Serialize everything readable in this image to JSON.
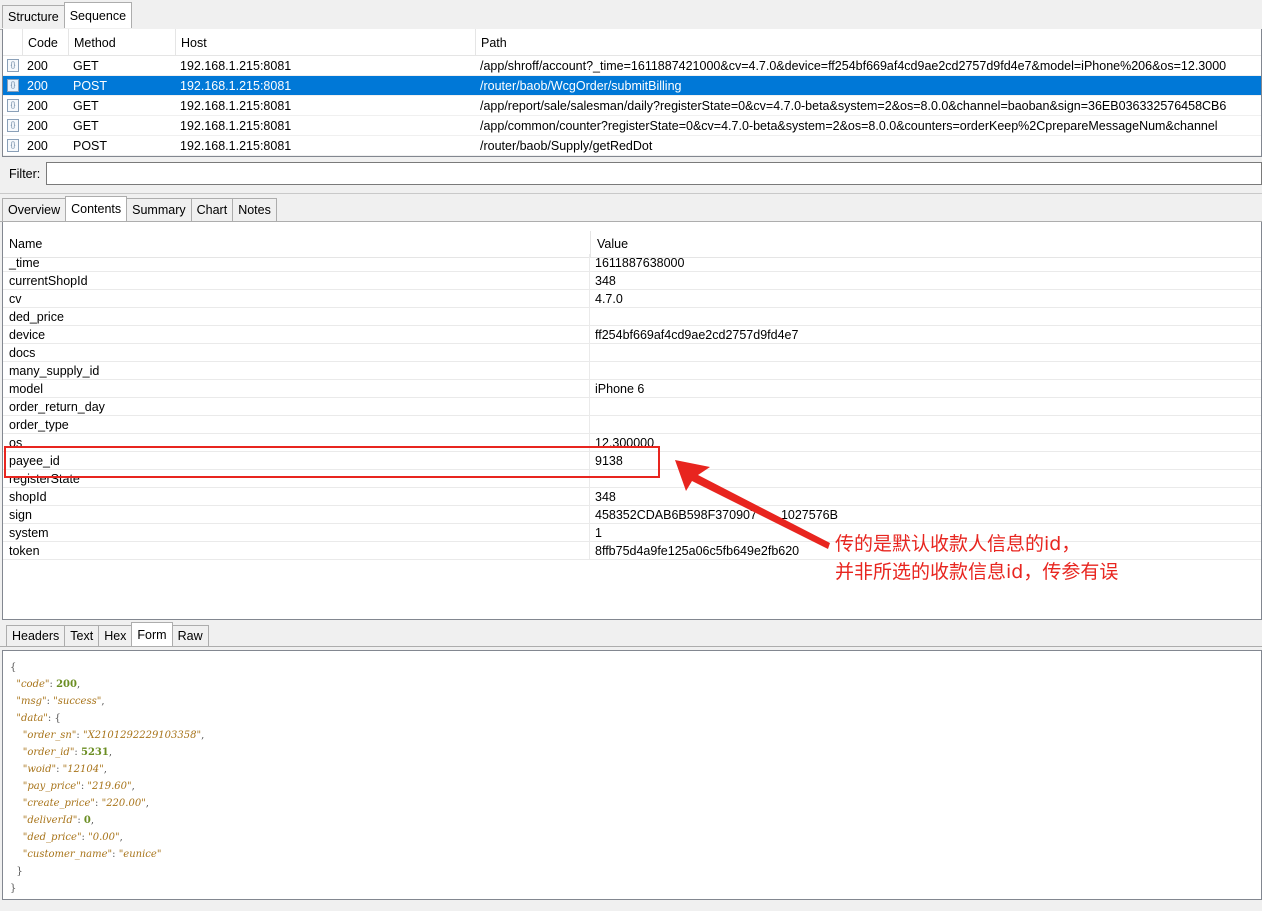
{
  "top_tabs": [
    {
      "label": "Structure",
      "active": false
    },
    {
      "label": "Sequence",
      "active": true
    }
  ],
  "sequence": {
    "columns": [
      "Code",
      "Method",
      "Host",
      "Path"
    ],
    "rows": [
      {
        "code": "200",
        "method": "GET",
        "host": "192.168.1.215:8081",
        "path": "/app/shroff/account?_time=1611887421000&cv=4.7.0&device=ff254bf669af4cd9ae2cd2757d9fd4e7&model=iPhone%206&os=12.3000",
        "selected": false
      },
      {
        "code": "200",
        "method": "POST",
        "host": "192.168.1.215:8081",
        "path": "/router/baob/WcgOrder/submitBilling",
        "selected": true
      },
      {
        "code": "200",
        "method": "GET",
        "host": "192.168.1.215:8081",
        "path": "/app/report/sale/salesman/daily?registerState=0&cv=4.7.0-beta&system=2&os=8.0.0&channel=baoban&sign=36EB036332576458CB6",
        "selected": false
      },
      {
        "code": "200",
        "method": "GET",
        "host": "192.168.1.215:8081",
        "path": "/app/common/counter?registerState=0&cv=4.7.0-beta&system=2&os=8.0.0&counters=orderKeep%2CprepareMessageNum&channel",
        "selected": false
      },
      {
        "code": "200",
        "method": "POST",
        "host": "192.168.1.215:8081",
        "path": "/router/baob/Supply/getRedDot",
        "selected": false
      }
    ]
  },
  "filter": {
    "label": "Filter:",
    "value": ""
  },
  "detail_tabs": [
    {
      "label": "Overview",
      "active": false
    },
    {
      "label": "Contents",
      "active": true
    },
    {
      "label": "Summary",
      "active": false
    },
    {
      "label": "Chart",
      "active": false
    },
    {
      "label": "Notes",
      "active": false
    }
  ],
  "contents": {
    "columns": [
      "Name",
      "Value"
    ],
    "rows": [
      {
        "name": "_time",
        "value": "1611887638000"
      },
      {
        "name": "currentShopId",
        "value": "348"
      },
      {
        "name": "cv",
        "value": "4.7.0"
      },
      {
        "name": "ded_price",
        "value": ""
      },
      {
        "name": "device",
        "value": "ff254bf669af4cd9ae2cd2757d9fd4e7"
      },
      {
        "name": "docs",
        "value": ""
      },
      {
        "name": "many_supply_id",
        "value": ""
      },
      {
        "name": "model",
        "value": "iPhone 6"
      },
      {
        "name": "order_return_day",
        "value": ""
      },
      {
        "name": "order_type",
        "value": ""
      },
      {
        "name": "os",
        "value": "12.300000"
      },
      {
        "name": "payee_id",
        "value": "9138"
      },
      {
        "name": "registerState",
        "value": ""
      },
      {
        "name": "shopId",
        "value": "348"
      },
      {
        "name": "sign",
        "value": "458352CDAB6B598F370907"
      },
      {
        "name": "system",
        "value": "1"
      },
      {
        "name": "token",
        "value": "8ffb75d4a9fe125a06c5fb649e2fb620"
      }
    ],
    "sign_tail": "1027576B"
  },
  "annotation": {
    "line1": "传的是默认收款人信息的id，",
    "line2": "并非所选的收款信息id，传参有误",
    "color": "#e8251f"
  },
  "response_tabs": [
    {
      "label": "Headers",
      "active": false
    },
    {
      "label": "Text",
      "active": false
    },
    {
      "label": "Hex",
      "active": false
    },
    {
      "label": "Form",
      "active": true
    },
    {
      "label": "Raw",
      "active": false
    }
  ],
  "response_json": {
    "code": "200",
    "msg": "success",
    "data": {
      "order_sn": "X2101292229103358",
      "order_id": "5231",
      "woid": "12104",
      "pay_price": "219.60",
      "create_price": "220.00",
      "deliverId": "0",
      "ded_price": "0.00",
      "customer_name": "eunice"
    }
  },
  "colors": {
    "selected_row": "#0078d7",
    "json_key": "#a8741a",
    "json_number": "#6b8e23"
  }
}
